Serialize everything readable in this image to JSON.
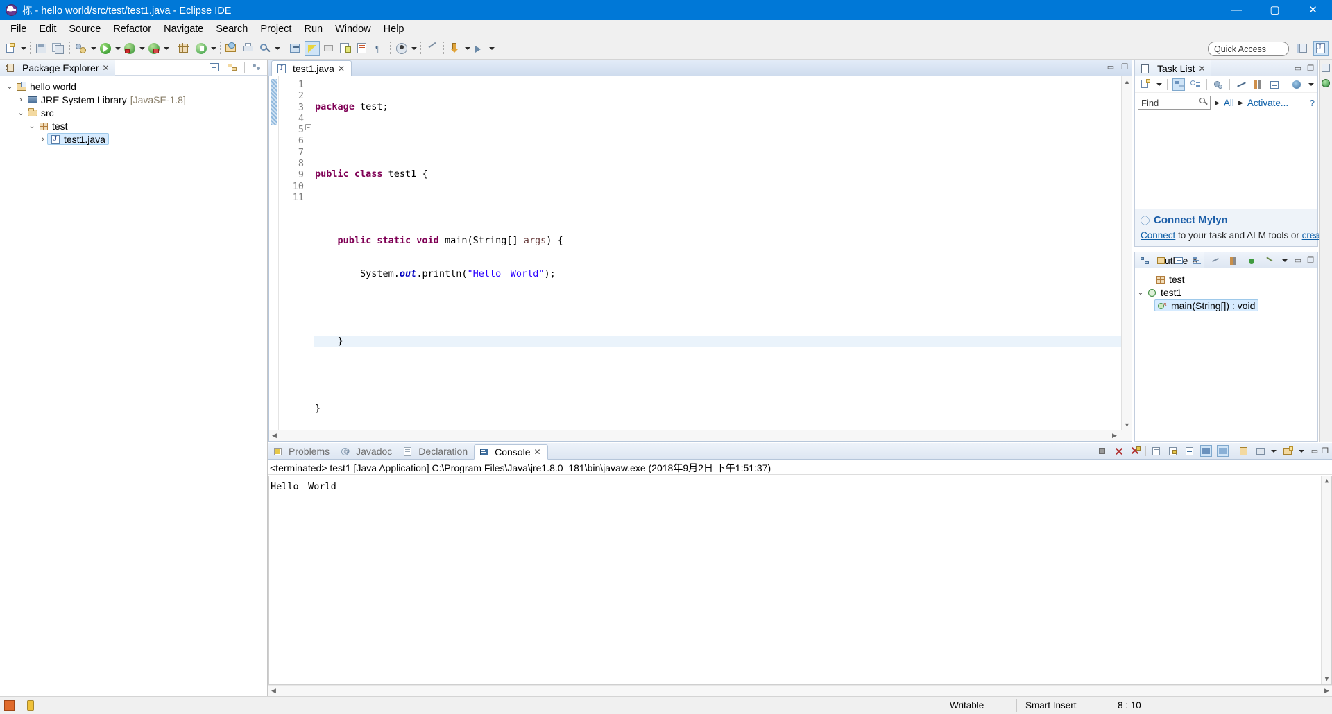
{
  "window": {
    "title": "栋 - hello world/src/test/test1.java - Eclipse IDE",
    "minimize": "—",
    "maximize": "▢",
    "close": "✕"
  },
  "menu": [
    "File",
    "Edit",
    "Source",
    "Refactor",
    "Navigate",
    "Search",
    "Project",
    "Run",
    "Window",
    "Help"
  ],
  "toolbar": {
    "quick_access_placeholder": "Quick Access"
  },
  "package_explorer": {
    "title": "Package Explorer",
    "close": "✕",
    "tree": [
      {
        "label": "hello world",
        "detail": "",
        "depth": 0,
        "twist": "v",
        "icon": "project-icon",
        "selected": false
      },
      {
        "label": "JRE System Library",
        "detail": "[JavaSE-1.8]",
        "depth": 1,
        "twist": ">",
        "icon": "jre-library-icon",
        "selected": false
      },
      {
        "label": "src",
        "detail": "",
        "depth": 1,
        "twist": "v",
        "icon": "source-folder-icon",
        "selected": false
      },
      {
        "label": "test",
        "detail": "",
        "depth": 2,
        "twist": "v",
        "icon": "package-icon",
        "selected": false
      },
      {
        "label": "test1.java",
        "detail": "",
        "depth": 3,
        "twist": ">",
        "icon": "java-file-icon",
        "selected": true
      }
    ]
  },
  "editor": {
    "tab_label": "test1.java",
    "tab_close": "✕",
    "current_line": 8,
    "marker_lines": [
      5,
      6,
      7,
      8
    ],
    "lines": [
      {
        "n": 1,
        "fold": "",
        "segments": [
          {
            "t": "package",
            "c": "kw"
          },
          {
            "t": " test;",
            "c": ""
          }
        ]
      },
      {
        "n": 2,
        "fold": "",
        "segments": []
      },
      {
        "n": 3,
        "fold": "",
        "segments": [
          {
            "t": "public class",
            "c": "kw"
          },
          {
            "t": " test1 {",
            "c": ""
          }
        ]
      },
      {
        "n": 4,
        "fold": "",
        "segments": []
      },
      {
        "n": 5,
        "fold": "minus",
        "segments": [
          {
            "t": "    ",
            "c": ""
          },
          {
            "t": "public static void",
            "c": "kw"
          },
          {
            "t": " main(String[] ",
            "c": ""
          },
          {
            "t": "args",
            "c": "param"
          },
          {
            "t": ") {",
            "c": ""
          }
        ]
      },
      {
        "n": 6,
        "fold": "",
        "segments": [
          {
            "t": "        System.",
            "c": ""
          },
          {
            "t": "out",
            "c": "fld"
          },
          {
            "t": ".println(",
            "c": ""
          },
          {
            "t": "\"Hello　World\"",
            "c": "str"
          },
          {
            "t": ");",
            "c": ""
          }
        ]
      },
      {
        "n": 7,
        "fold": "",
        "segments": []
      },
      {
        "n": 8,
        "fold": "",
        "segments": [
          {
            "t": "    }",
            "c": ""
          }
        ]
      },
      {
        "n": 9,
        "fold": "",
        "segments": []
      },
      {
        "n": 10,
        "fold": "",
        "segments": [
          {
            "t": "}",
            "c": ""
          }
        ]
      },
      {
        "n": 11,
        "fold": "",
        "segments": []
      }
    ]
  },
  "task_list": {
    "title": "Task List",
    "close": "✕",
    "find_placeholder": "Find",
    "filter_all": "All",
    "filter_activate": "Activate...",
    "mylyn": {
      "title": "Connect Mylyn",
      "info_icon": "ⓘ",
      "text_link1": "Connect",
      "text_mid": " to your task and ALM tools or ",
      "text_link2": "creat"
    }
  },
  "outline": {
    "title": "Outline",
    "close": "✕",
    "items": [
      {
        "label": "test",
        "icon": "package-icon",
        "depth": 0,
        "twist": "",
        "selected": false
      },
      {
        "label": "test1",
        "icon": "class-icon",
        "depth": 0,
        "twist": "v",
        "selected": false
      },
      {
        "label": "main(String[]) : void",
        "icon": "method-icon",
        "depth": 1,
        "twist": "",
        "selected": true
      }
    ]
  },
  "console": {
    "tabs": [
      {
        "label": "Problems",
        "icon": "problems-icon",
        "active": false
      },
      {
        "label": "Javadoc",
        "icon": "javadoc-icon",
        "active": false
      },
      {
        "label": "Declaration",
        "icon": "declaration-icon",
        "active": false
      },
      {
        "label": "Console",
        "icon": "console-icon",
        "active": true
      }
    ],
    "tab_close": "✕",
    "terminated_line": "<terminated> test1 [Java Application] C:\\Program Files\\Java\\jre1.8.0_181\\bin\\javaw.exe (2018年9月2日 下午1:51:37)",
    "output": "Hello　World"
  },
  "statusbar": {
    "writable": "Writable",
    "insert_mode": "Smart Insert",
    "cursor_position": "8 : 10"
  },
  "colors": {
    "titlebar": "#0078d7",
    "keyword": "#7f0055",
    "string": "#2a00ff",
    "field": "#0000c0",
    "link": "#0d5fa8",
    "selection": "#d6ebff"
  }
}
